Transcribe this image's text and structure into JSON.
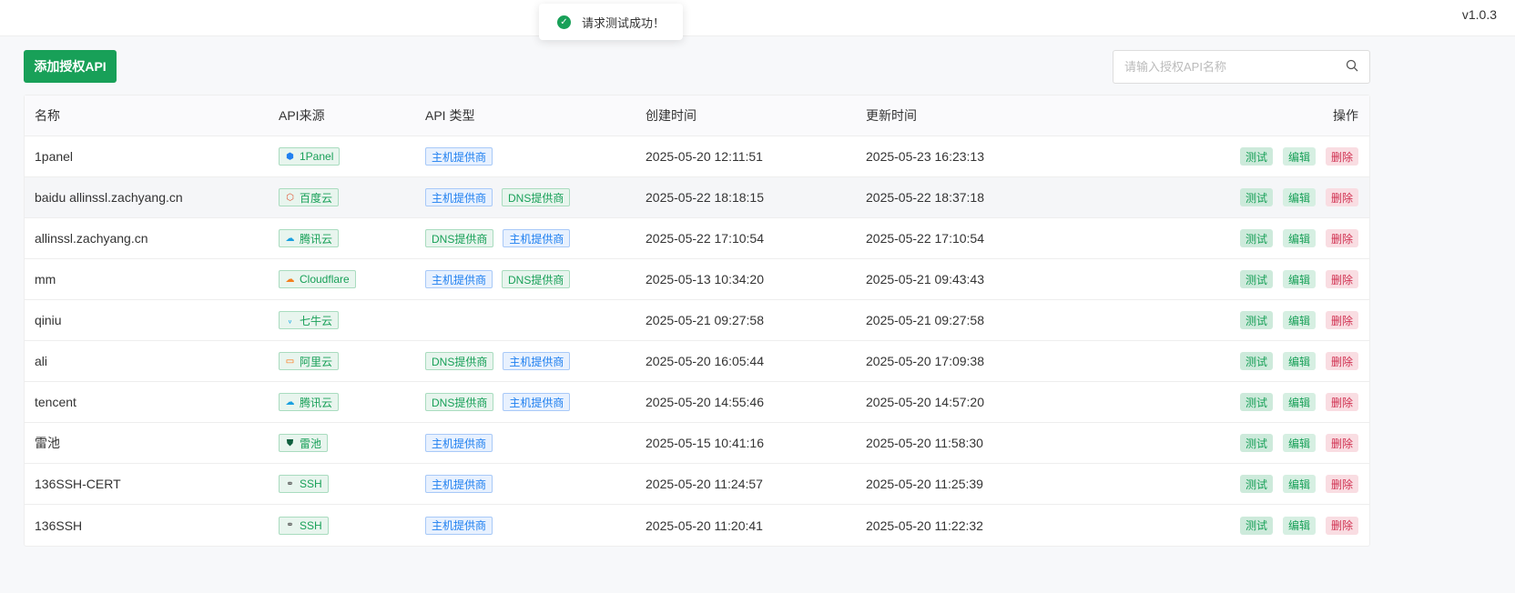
{
  "version": "v1.0.3",
  "toast": "请求测试成功！",
  "add_button": "添加授权API",
  "search_placeholder": "请输入授权API名称",
  "headers": [
    "名称",
    "API来源",
    "API 类型",
    "创建时间",
    "更新时间",
    "操作"
  ],
  "actions": {
    "test": "测试",
    "edit": "编辑",
    "delete": "删除"
  },
  "rows": [
    {
      "name": "1panel",
      "source": "1Panel",
      "icon": "1panel-icon",
      "types": [
        "主机提供商"
      ],
      "created": "2025-05-20 12:11:51",
      "updated": "2025-05-23 16:23:13"
    },
    {
      "name": "baidu allinssl.zachyang.cn",
      "source": "百度云",
      "icon": "baidu-cloud-icon",
      "types": [
        "主机提供商",
        "DNS提供商"
      ],
      "created": "2025-05-22 18:18:15",
      "updated": "2025-05-22 18:37:18"
    },
    {
      "name": "allinssl.zachyang.cn",
      "source": "腾讯云",
      "icon": "tencent-cloud-icon",
      "types": [
        "DNS提供商",
        "主机提供商"
      ],
      "created": "2025-05-22 17:10:54",
      "updated": "2025-05-22 17:10:54"
    },
    {
      "name": "mm",
      "source": "Cloudflare",
      "icon": "cloudflare-icon",
      "types": [
        "主机提供商",
        "DNS提供商"
      ],
      "created": "2025-05-13 10:34:20",
      "updated": "2025-05-21 09:43:43"
    },
    {
      "name": "qiniu",
      "source": "七牛云",
      "icon": "qiniu-icon",
      "types": [],
      "created": "2025-05-21 09:27:58",
      "updated": "2025-05-21 09:27:58"
    },
    {
      "name": "ali",
      "source": "阿里云",
      "icon": "aliyun-icon",
      "types": [
        "DNS提供商",
        "主机提供商"
      ],
      "created": "2025-05-20 16:05:44",
      "updated": "2025-05-20 17:09:38"
    },
    {
      "name": "tencent",
      "source": "腾讯云",
      "icon": "tencent-cloud-icon",
      "types": [
        "DNS提供商",
        "主机提供商"
      ],
      "created": "2025-05-20 14:55:46",
      "updated": "2025-05-20 14:57:20"
    },
    {
      "name": "雷池",
      "source": "雷池",
      "icon": "safeline-icon",
      "types": [
        "主机提供商"
      ],
      "created": "2025-05-15 10:41:16",
      "updated": "2025-05-20 11:58:30"
    },
    {
      "name": "136SSH-CERT",
      "source": "SSH",
      "icon": "link-icon",
      "types": [
        "主机提供商"
      ],
      "created": "2025-05-20 11:24:57",
      "updated": "2025-05-20 11:25:39"
    },
    {
      "name": "136SSH",
      "source": "SSH",
      "icon": "link-icon",
      "types": [
        "主机提供商"
      ],
      "created": "2025-05-20 11:20:41",
      "updated": "2025-05-20 11:22:32"
    }
  ]
}
